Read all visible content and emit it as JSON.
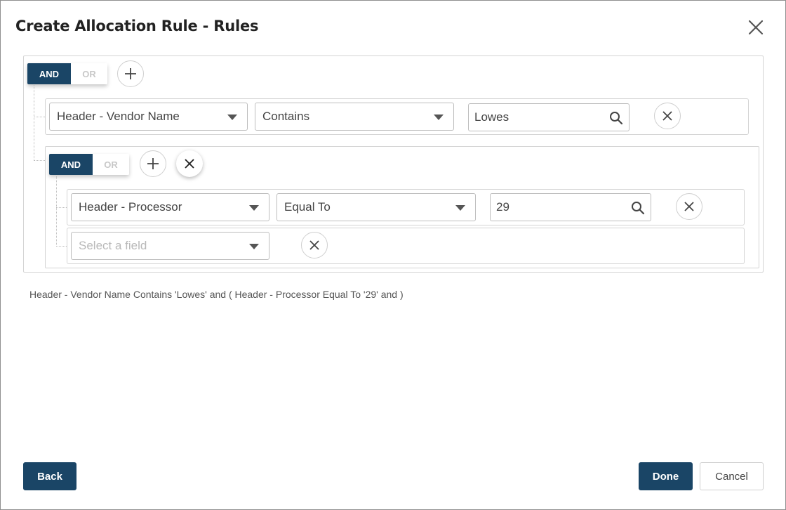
{
  "dialog": {
    "title": "Create Allocation Rule - Rules",
    "close_icon": "close-icon"
  },
  "outer_group": {
    "toggle": {
      "and_label": "AND",
      "or_label": "OR",
      "selected": "AND"
    },
    "add_icon": "plus-icon",
    "rule": {
      "field": "Header - Vendor Name",
      "operator": "Contains",
      "value": "Lowes"
    }
  },
  "inner_group": {
    "toggle": {
      "and_label": "AND",
      "or_label": "OR",
      "selected": "AND"
    },
    "add_icon": "plus-icon",
    "remove_icon": "close-icon",
    "rules": [
      {
        "field": "Header - Processor",
        "operator": "Equal To",
        "value": "29"
      },
      {
        "field_placeholder": "Select a field"
      }
    ]
  },
  "summary": "Header - Vendor Name Contains 'Lowes' and ( Header - Processor Equal To '29' and )",
  "footer": {
    "back_label": "Back",
    "done_label": "Done",
    "cancel_label": "Cancel"
  },
  "colors": {
    "primary": "#1a4566",
    "border": "#d4d4d4"
  }
}
